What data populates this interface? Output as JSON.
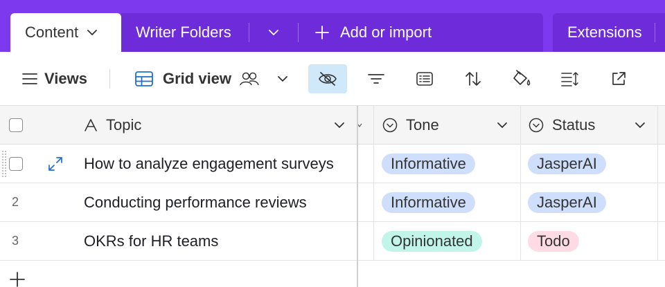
{
  "tabs": {
    "active_label": "Content",
    "folders_label": "Writer Folders",
    "add_label": "Add or import",
    "extensions_label": "Extensions"
  },
  "toolbar": {
    "views_label": "Views",
    "grid_view_label": "Grid view",
    "buttons": [
      "hide-fields",
      "filter",
      "group",
      "sort",
      "color",
      "row-height",
      "share"
    ]
  },
  "grid": {
    "columns": [
      {
        "name": "Topic",
        "icon": "text-field-icon"
      },
      {
        "name": "Tone",
        "icon": "single-select-icon"
      },
      {
        "name": "Status",
        "icon": "single-select-icon"
      }
    ],
    "rows": [
      {
        "num": "",
        "topic": "How to analyze engagement surveys",
        "tone": "Informative",
        "status": "JasperAI"
      },
      {
        "num": "2",
        "topic": "Conducting performance reviews",
        "tone": "Informative",
        "status": "JasperAI"
      },
      {
        "num": "3",
        "topic": "OKRs for HR teams",
        "tone": "Opinionated",
        "status": "Todo"
      }
    ]
  },
  "colors": {
    "header_purple": "#7c39ed",
    "tab_group_purple": "#6d2bd9",
    "informative_pill": "#cfdffb",
    "opinionated_pill": "#c2f5e9",
    "jasperai_pill": "#cfdffb",
    "todo_pill": "#ffdce5",
    "active_button_bg": "#cfe9fb",
    "link_blue": "#1f6fd1"
  }
}
